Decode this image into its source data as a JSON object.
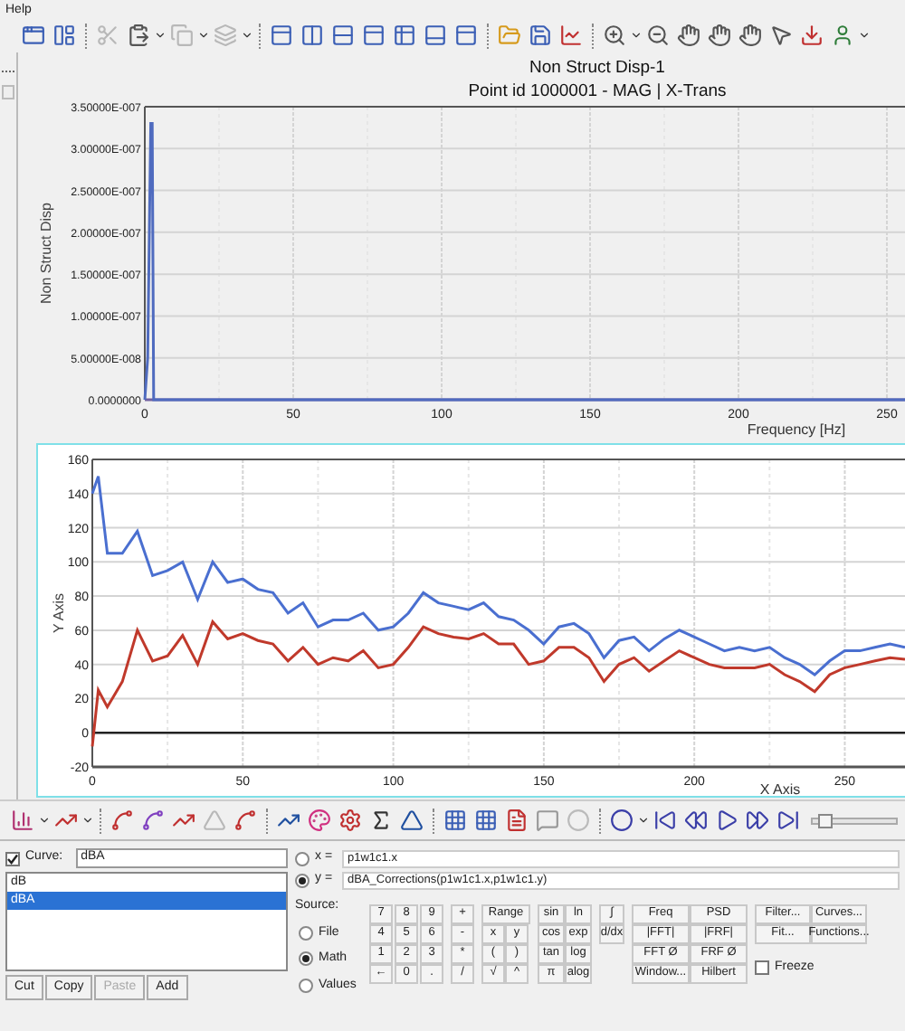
{
  "menu": [
    {
      "label": "Help"
    }
  ],
  "top_plot": {
    "subtitle": "Point id 1000001 - MAG | X-Trans",
    "chart_data": {
      "type": "line",
      "title": "Non Struct Disp-1",
      "xlabel": "Frequency [Hz]",
      "ylabel": "Non Struct Disp",
      "x": [
        0,
        1,
        2,
        2.5,
        3,
        4,
        6,
        275
      ],
      "series": [
        {
          "color": "#4f6bbf",
          "values": [
            0,
            5e-08,
            3.3e-07,
            3.3e-07,
            0,
            0,
            0,
            0
          ]
        }
      ],
      "grid": true,
      "xlim": [
        0,
        275
      ],
      "ylim": [
        0,
        3.5e-07
      ],
      "xticks": [
        0,
        50,
        100,
        150,
        200,
        250
      ],
      "yticks": [
        {
          "value": 0,
          "label": "0.0000000"
        },
        {
          "value": 5e-08,
          "label": "5.00000E-008"
        },
        {
          "value": 1e-07,
          "label": "1.00000E-007"
        },
        {
          "value": 1.5e-07,
          "label": "1.50000E-007"
        },
        {
          "value": 2e-07,
          "label": "2.00000E-007"
        },
        {
          "value": 2.5e-07,
          "label": "2.50000E-007"
        },
        {
          "value": 3e-07,
          "label": "3.00000E-007"
        },
        {
          "value": 3.5e-07,
          "label": "3.50000E-007"
        }
      ]
    }
  },
  "bottom_plot": {
    "chart_data": {
      "type": "line",
      "xlabel": "X Axis",
      "ylabel": "Y Axis",
      "x": [
        0,
        2,
        5,
        10,
        15,
        20,
        25,
        30,
        35,
        40,
        45,
        50,
        55,
        60,
        65,
        70,
        75,
        80,
        85,
        90,
        95,
        100,
        105,
        110,
        115,
        120,
        125,
        130,
        135,
        140,
        145,
        150,
        155,
        160,
        165,
        170,
        175,
        180,
        185,
        190,
        195,
        200,
        205,
        210,
        215,
        220,
        225,
        230,
        235,
        240,
        245,
        250,
        255,
        260,
        265,
        270
      ],
      "series": [
        {
          "color": "#4a6fd0",
          "values": [
            140,
            150,
            105,
            105,
            118,
            92,
            95,
            100,
            78,
            100,
            88,
            90,
            84,
            82,
            70,
            76,
            62,
            66,
            66,
            70,
            60,
            62,
            70,
            82,
            76,
            74,
            72,
            76,
            68,
            66,
            60,
            52,
            62,
            64,
            58,
            44,
            54,
            56,
            48,
            55,
            60,
            56,
            52,
            48,
            50,
            48,
            50,
            44,
            40,
            34,
            42,
            48,
            48,
            50,
            52,
            50
          ]
        },
        {
          "color": "#c0392b",
          "values": [
            -8,
            25,
            15,
            30,
            60,
            42,
            45,
            57,
            40,
            65,
            55,
            58,
            54,
            52,
            42,
            50,
            40,
            44,
            42,
            48,
            38,
            40,
            50,
            62,
            58,
            56,
            55,
            58,
            52,
            52,
            40,
            42,
            50,
            50,
            44,
            30,
            40,
            44,
            36,
            42,
            48,
            44,
            40,
            38,
            38,
            38,
            40,
            34,
            30,
            24,
            34,
            38,
            40,
            42,
            44,
            43
          ]
        }
      ],
      "grid": true,
      "xlim": [
        0,
        270
      ],
      "ylim": [
        -20,
        160
      ],
      "xticks": [
        0,
        50,
        100,
        150,
        200,
        250
      ],
      "yticks": [
        -20,
        0,
        20,
        40,
        60,
        80,
        100,
        120,
        140,
        160
      ]
    }
  },
  "animation_slider": {
    "level": 0.08
  },
  "curve_panel": {
    "curve_checkbox": {
      "label": "Curve:",
      "checked": true
    },
    "curve_name": "dBA",
    "curves": [
      {
        "label": "dB",
        "selected": false
      },
      {
        "label": "dBA",
        "selected": true
      }
    ],
    "buttons": [
      {
        "label": "Cut",
        "disabled": false
      },
      {
        "label": "Copy",
        "disabled": false
      },
      {
        "label": "Paste",
        "disabled": true
      },
      {
        "label": "Add",
        "disabled": false
      }
    ],
    "axes": [
      {
        "label": "x =",
        "selected": false,
        "value": "p1w1c1.x"
      },
      {
        "label": "y =",
        "selected": true,
        "value": "dBA_Corrections(p1w1c1.x,p1w1c1.y)"
      }
    ],
    "source_label": "Source:",
    "sources": [
      {
        "label": "File",
        "selected": false
      },
      {
        "label": "Math",
        "selected": true
      },
      {
        "label": "Values",
        "selected": false
      }
    ],
    "digits": [
      [
        "7",
        "8",
        "9",
        "+"
      ],
      [
        "4",
        "5",
        "6",
        "-"
      ],
      [
        "1",
        "2",
        "3",
        "*"
      ],
      [
        "←",
        "0",
        ".",
        "/"
      ]
    ],
    "range": "Range",
    "ops": [
      [
        "x",
        "y"
      ],
      [
        "(",
        ")"
      ],
      [
        "√",
        "^"
      ]
    ],
    "math": [
      [
        "sin",
        "ln"
      ],
      [
        "cos",
        "exp"
      ],
      [
        "tan",
        "log"
      ],
      [
        "π",
        "alog"
      ]
    ],
    "calculus": [
      "∫",
      "d/dx"
    ],
    "spectral": [
      [
        "Freq",
        "PSD"
      ],
      [
        "|FFT|",
        "|FRF|"
      ],
      [
        "FFT Ø",
        "FRF Ø"
      ],
      [
        "Window...",
        "Hilbert"
      ]
    ],
    "tools": [
      [
        "Filter...",
        "Curves..."
      ],
      [
        "Fit...",
        "Functions..."
      ]
    ],
    "freeze": {
      "label": "Freeze",
      "checked": false
    }
  }
}
